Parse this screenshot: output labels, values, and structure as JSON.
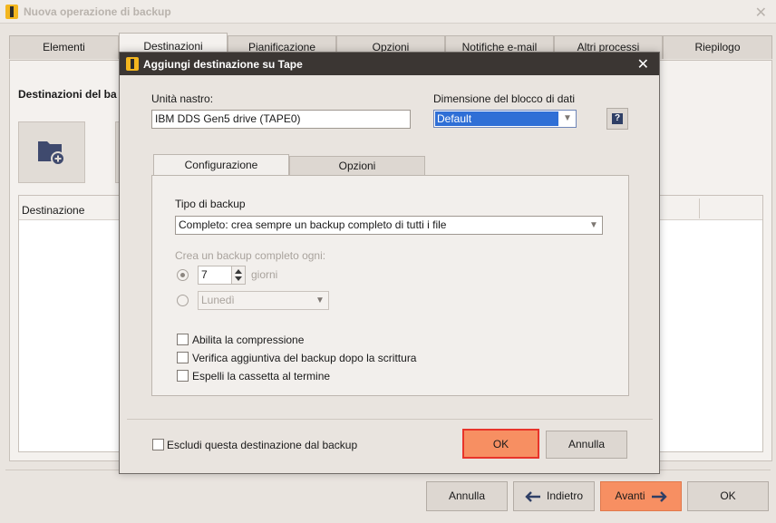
{
  "main_window": {
    "title": "Nuova operazione di backup",
    "tabs": [
      "Elementi",
      "Destinazioni",
      "Pianificazione",
      "Opzioni",
      "Notifiche e-mail",
      "Altri processi",
      "Riepilogo"
    ],
    "section_title": "Destinazioni del ba",
    "table_header": "Destinazione",
    "buttons": {
      "cancel": "Annulla",
      "back": "Indietro",
      "next": "Avanti",
      "ok": "OK"
    }
  },
  "dialog": {
    "title": "Aggiungi destinazione su Tape",
    "tape_unit_label": "Unità nastro:",
    "tape_unit_value": "IBM DDS Gen5 drive (TAPE0)",
    "block_size_label": "Dimensione del blocco di dati",
    "block_size_value": "Default",
    "help_label": "?",
    "tabs": [
      "Configurazione",
      "Opzioni"
    ],
    "backup_type_label": "Tipo di backup",
    "backup_type_value": "Completo: crea sempre un backup completo di tutti i file",
    "full_every_label": "Crea un backup completo ogni:",
    "days_value": "7",
    "days_label": "giorni",
    "weekday_value": "Lunedì",
    "checkboxes": {
      "compression": "Abilita la compressione",
      "verify": "Verifica aggiuntiva del backup dopo la scrittura",
      "eject": "Espelli la cassetta al termine"
    },
    "exclude_label": "Escludi questa destinazione dal backup",
    "ok_button": "OK",
    "cancel_button": "Annulla"
  },
  "colors": {
    "accent_orange": "#f78f62",
    "dialog_titlebar": "#3b3633",
    "selection_blue": "#2f6fd6"
  }
}
